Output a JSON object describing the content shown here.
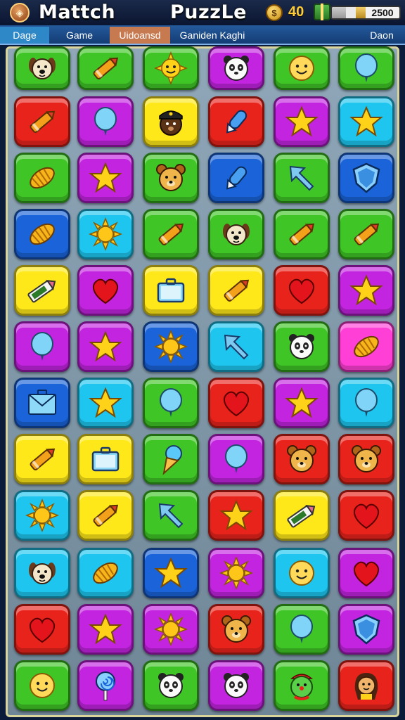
{
  "header": {
    "title_left": "Mattch",
    "title_right": "PuzzLe",
    "coin_count": "40",
    "points": "2500",
    "progress": 0.6
  },
  "tabs": [
    "Dage",
    "Game",
    "Uidoansd",
    "Ganiden Kaghi",
    "Daon"
  ],
  "colors": {
    "green": "#3fc526",
    "red": "#e8231b",
    "magenta": "#c324e0",
    "yellow": "#ffe81a",
    "cyan": "#1ec6ef",
    "blue": "#1a63d8",
    "pink": "#ff3fd6"
  },
  "board": {
    "rows": [
      [
        [
          "green",
          "dog-icon"
        ],
        [
          "green",
          "crayon-icon"
        ],
        [
          "green",
          "sun-face-icon"
        ],
        [
          "magenta",
          "panda-icon"
        ],
        [
          "green",
          "smiley-face-icon"
        ],
        [
          "green",
          "balloon-icon"
        ]
      ],
      [
        [
          "red",
          "crayon-icon"
        ],
        [
          "magenta",
          "balloon-icon"
        ],
        [
          "yellow",
          "police-bear-icon"
        ],
        [
          "red",
          "rocket-icon"
        ],
        [
          "magenta",
          "star-icon"
        ],
        [
          "cyan",
          "star-icon"
        ]
      ],
      [
        [
          "green",
          "croissant-icon"
        ],
        [
          "magenta",
          "star-icon"
        ],
        [
          "green",
          "bear-icon"
        ],
        [
          "blue",
          "rocket-icon"
        ],
        [
          "green",
          "arrow-icon"
        ],
        [
          "blue",
          "shield-icon"
        ]
      ],
      [
        [
          "blue",
          "croissant-icon"
        ],
        [
          "cyan",
          "sun-icon"
        ],
        [
          "green",
          "crayon-icon"
        ],
        [
          "green",
          "dog-icon"
        ],
        [
          "green",
          "crayon-icon"
        ],
        [
          "green",
          "crayon-icon"
        ]
      ],
      [
        [
          "yellow",
          "pencil-icon"
        ],
        [
          "magenta",
          "heart-icon"
        ],
        [
          "yellow",
          "briefcase-icon"
        ],
        [
          "yellow",
          "crayon-icon"
        ],
        [
          "red",
          "heart-icon"
        ],
        [
          "magenta",
          "star-icon"
        ]
      ],
      [
        [
          "magenta",
          "balloon-icon"
        ],
        [
          "magenta",
          "star-icon"
        ],
        [
          "blue",
          "sun-icon"
        ],
        [
          "cyan",
          "arrow-icon"
        ],
        [
          "green",
          "panda-icon"
        ],
        [
          "pink",
          "croissant-icon"
        ]
      ],
      [
        [
          "blue",
          "envelope-icon"
        ],
        [
          "cyan",
          "star-icon"
        ],
        [
          "green",
          "balloon-icon"
        ],
        [
          "red",
          "heart-icon"
        ],
        [
          "magenta",
          "star-icon"
        ],
        [
          "cyan",
          "balloon-icon"
        ]
      ],
      [
        [
          "yellow",
          "crayon-icon"
        ],
        [
          "yellow",
          "briefcase-icon"
        ],
        [
          "green",
          "ice-cream-icon"
        ],
        [
          "magenta",
          "balloon-icon"
        ],
        [
          "red",
          "bear-icon"
        ],
        [
          "red",
          "bear-icon"
        ]
      ],
      [
        [
          "cyan",
          "sun-icon"
        ],
        [
          "yellow",
          "crayon-icon"
        ],
        [
          "green",
          "arrow-icon"
        ],
        [
          "red",
          "star-icon"
        ],
        [
          "yellow",
          "pencil-icon"
        ],
        [
          "red",
          "heart-icon"
        ]
      ],
      [
        [
          "cyan",
          "dog-icon"
        ],
        [
          "cyan",
          "croissant-icon"
        ],
        [
          "blue",
          "star-icon"
        ],
        [
          "magenta",
          "sun-icon"
        ],
        [
          "cyan",
          "smiley-face-icon"
        ],
        [
          "magenta",
          "heart-icon"
        ]
      ],
      [
        [
          "red",
          "heart-icon"
        ],
        [
          "magenta",
          "star-icon"
        ],
        [
          "magenta",
          "sun-icon"
        ],
        [
          "red",
          "bear-icon"
        ],
        [
          "green",
          "balloon-icon"
        ],
        [
          "magenta",
          "shield-icon"
        ]
      ],
      [
        [
          "green",
          "smiley-face-icon"
        ],
        [
          "magenta",
          "lollipop-icon"
        ],
        [
          "green",
          "panda-icon"
        ],
        [
          "magenta",
          "panda-icon"
        ],
        [
          "green",
          "clown-icon"
        ],
        [
          "red",
          "girl-icon"
        ]
      ]
    ]
  }
}
